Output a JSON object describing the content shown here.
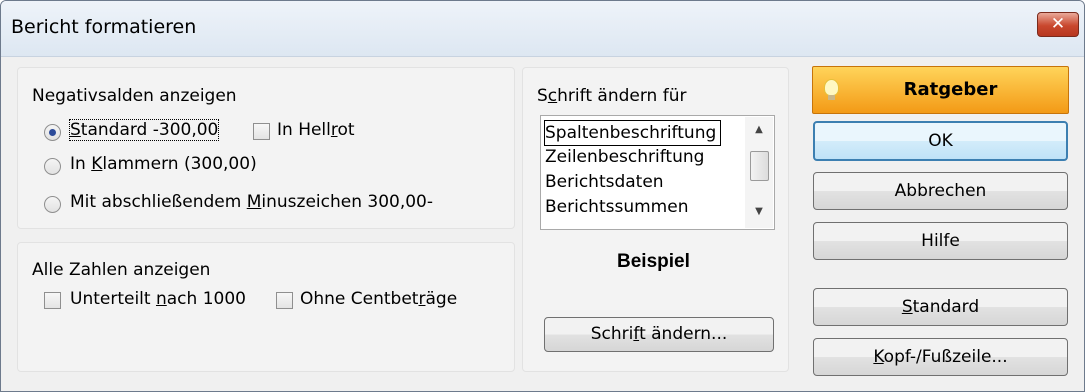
{
  "window": {
    "title": "Bericht formatieren",
    "close_glyph": "✕"
  },
  "negative": {
    "heading": "Negativsalden anzeigen",
    "options": [
      {
        "pre": "",
        "key": "S",
        "post": "tandard -300,00",
        "selected": true
      },
      {
        "pre": "In ",
        "key": "K",
        "post": "lammern (300,00)",
        "selected": false
      },
      {
        "pre": "Mit abschließendem ",
        "key": "M",
        "post": "inuszeichen 300,00-",
        "selected": false
      }
    ],
    "hellrot": {
      "pre": "In Hell",
      "key": "r",
      "post": "ot",
      "checked": false
    }
  },
  "numbers": {
    "heading": "Alle Zahlen anzeigen",
    "unterteilt": {
      "pre": "Unterteilt ",
      "key": "n",
      "post": "ach 1000",
      "checked": false
    },
    "ohne_cent": {
      "pre": "Ohne Centbet",
      "key": "r",
      "post": "äge",
      "checked": false
    }
  },
  "font": {
    "heading_pre": "S",
    "heading_key": "c",
    "heading_post": "hrift ändern für",
    "items": [
      "Spaltenbeschriftung",
      "Zeilenbeschriftung",
      "Berichtsdaten",
      "Berichtssummen"
    ],
    "sample": "Beispiel",
    "button": {
      "pre": "Schri",
      "key": "f",
      "post": "t ändern..."
    }
  },
  "buttons": {
    "ratgeber": "Ratgeber",
    "ok": "OK",
    "cancel": "Abbrechen",
    "help": "Hilfe",
    "standard": {
      "pre": "",
      "key": "S",
      "post": "tandard"
    },
    "header_footer": {
      "pre": "",
      "key": "K",
      "post": "opf-/Fußzeile..."
    }
  },
  "icons": {
    "ratgeber": "lightbulb-icon",
    "close": "close-icon",
    "scroll_up": "chevron-up-icon",
    "scroll_down": "chevron-down-icon"
  },
  "colors": {
    "ratgeber_top": "#ffd45a",
    "ratgeber_bottom": "#f39a16",
    "close": "#c9482e",
    "default_button_border": "#3c7fb1"
  }
}
